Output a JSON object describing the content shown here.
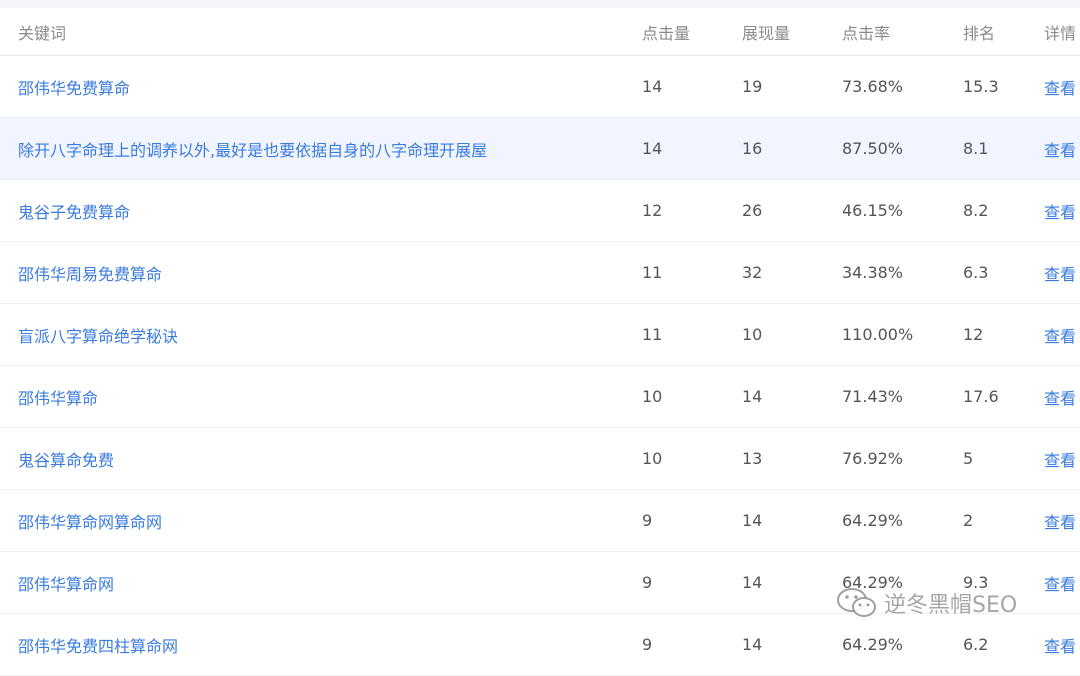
{
  "table": {
    "headers": {
      "keyword": "关键词",
      "clicks": "点击量",
      "impressions": "展现量",
      "ctr": "点击率",
      "rank": "排名",
      "detail": "详情"
    },
    "rows": [
      {
        "keyword": "邵伟华免费算命",
        "clicks": "14",
        "impressions": "19",
        "ctr": "73.68%",
        "rank": "15.3",
        "detail": "查看"
      },
      {
        "keyword": "除开八字命理上的调养以外,最好是也要依据自身的八字命理开展屋",
        "clicks": "14",
        "impressions": "16",
        "ctr": "87.50%",
        "rank": "8.1",
        "detail": "查看",
        "highlighted": true
      },
      {
        "keyword": "鬼谷子免费算命",
        "clicks": "12",
        "impressions": "26",
        "ctr": "46.15%",
        "rank": "8.2",
        "detail": "查看"
      },
      {
        "keyword": "邵伟华周易免费算命",
        "clicks": "11",
        "impressions": "32",
        "ctr": "34.38%",
        "rank": "6.3",
        "detail": "查看"
      },
      {
        "keyword": "盲派八字算命绝学秘诀",
        "clicks": "11",
        "impressions": "10",
        "ctr": "110.00%",
        "rank": "12",
        "detail": "查看"
      },
      {
        "keyword": "邵伟华算命",
        "clicks": "10",
        "impressions": "14",
        "ctr": "71.43%",
        "rank": "17.6",
        "detail": "查看"
      },
      {
        "keyword": "鬼谷算命免费",
        "clicks": "10",
        "impressions": "13",
        "ctr": "76.92%",
        "rank": "5",
        "detail": "查看"
      },
      {
        "keyword": "邵伟华算命网算命网",
        "clicks": "9",
        "impressions": "14",
        "ctr": "64.29%",
        "rank": "2",
        "detail": "查看"
      },
      {
        "keyword": "邵伟华算命网",
        "clicks": "9",
        "impressions": "14",
        "ctr": "64.29%",
        "rank": "9.3",
        "detail": "查看"
      },
      {
        "keyword": "邵伟华免费四柱算命网",
        "clicks": "9",
        "impressions": "14",
        "ctr": "64.29%",
        "rank": "6.2",
        "detail": "查看"
      }
    ]
  },
  "watermark": {
    "text": "逆冬黑帽SEO",
    "icon": "wechat-icon"
  },
  "colors": {
    "link": "#3a7be0",
    "highlight_row": "#f1f5ff",
    "divider": "#eef0f3"
  }
}
